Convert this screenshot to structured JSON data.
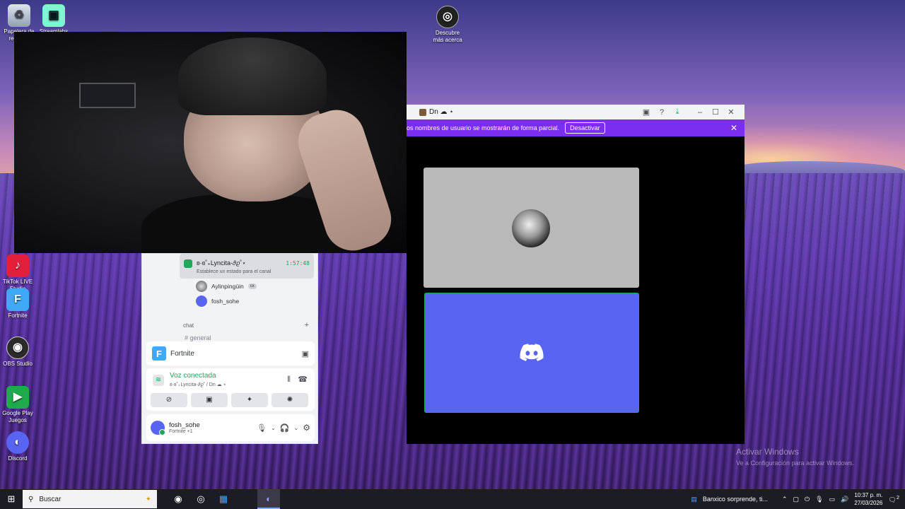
{
  "desktop": {
    "icons": [
      {
        "label": "Papelera de reciclaje",
        "icon": "recycle-bin-icon"
      },
      {
        "label": "Streamlabs",
        "icon": "streamlabs-icon"
      },
      {
        "label": "Descubre más acerca",
        "icon": "discover-icon"
      },
      {
        "label": "TikTok LIVE Studio",
        "icon": "tiktok-icon"
      },
      {
        "label": "Fortnite",
        "icon": "fortnite-icon"
      },
      {
        "label": "OBS Studio",
        "icon": "obs-icon"
      },
      {
        "label": "Google Play Juegos",
        "icon": "google-play-icon"
      },
      {
        "label": "Discord",
        "icon": "discord-icon"
      }
    ],
    "watermark_title": "Activar Windows",
    "watermark_sub": "Ve a Configuración para activar Windows."
  },
  "voice_window": {
    "title": "Dn ☁ ⋆",
    "banner_text": "os nombres de usuario se mostrarán de forma parcial.",
    "banner_button": "Desactivar"
  },
  "panel": {
    "voice_user": "ʚ·ɞ˚₊Lyncita-𝜗𝜚˚⋆",
    "voice_time": "1:57:48",
    "voice_status": "Establece un estado para el canal",
    "members": [
      {
        "name": "Aylinpingüin",
        "badge": "cx"
      },
      {
        "name": "fosh_sohe",
        "badge": ""
      }
    ],
    "chat_category": "chat",
    "channel": "general",
    "game_name": "Fortnite",
    "voice_connected": "Voz conectada",
    "voice_channel": "ʚ·ɞ˚₊Lyncita-𝜗𝜚˚ / Dn ☁ ⋆",
    "username": "fosh_sohe",
    "activity": "Fortnite +1"
  },
  "taskbar": {
    "search_placeholder": "Buscar",
    "news": "Banxico sorprende, ti...",
    "time": "10:37 p. m.",
    "date": "27/03/2026",
    "notifications": "2"
  },
  "colors": {
    "discord_blurple": "#5865f2",
    "discord_green": "#23a55a",
    "banner_purple": "#7b2df0"
  }
}
